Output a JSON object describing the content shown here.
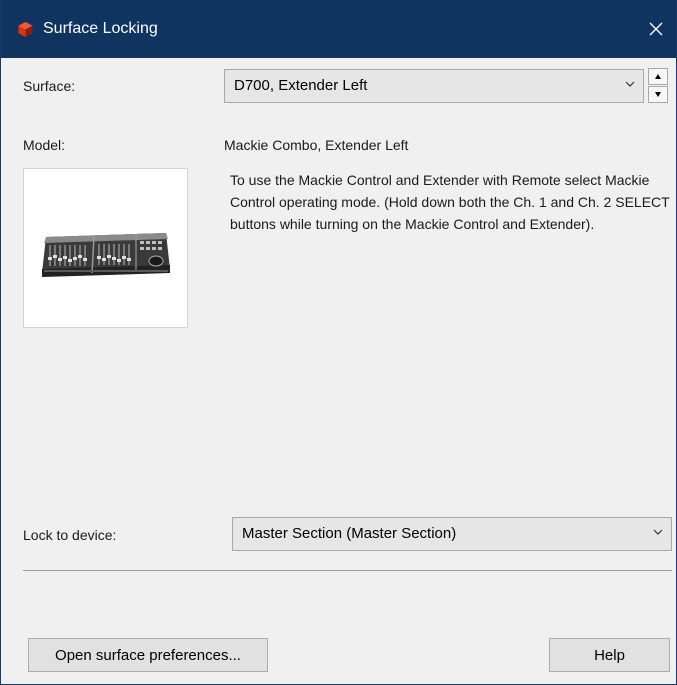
{
  "window": {
    "title": "Surface Locking",
    "close_glyph": "✕"
  },
  "surface": {
    "label": "Surface:",
    "selected": "D700, Extender Left"
  },
  "model": {
    "label": "Model:",
    "name": "Mackie Combo, Extender Left",
    "description": "To use the Mackie Control and Extender with Remote select Mackie Control operating mode. (Hold down both the Ch. 1 and Ch. 2 SELECT buttons while turning on the Mackie Control and Extender)."
  },
  "lock": {
    "label": "Lock to device:",
    "selected": "Master Section (Master Section)"
  },
  "buttons": {
    "open_prefs": "Open surface preferences...",
    "help": "Help"
  },
  "colors": {
    "titlebar": "#0f3460",
    "app_icon": "#d8341c"
  },
  "icons": {
    "app": "reason-app-icon",
    "close": "close-icon",
    "dropdown": "chevron-down-icon",
    "spin_up": "arrow-up-icon",
    "spin_down": "arrow-down-icon"
  }
}
